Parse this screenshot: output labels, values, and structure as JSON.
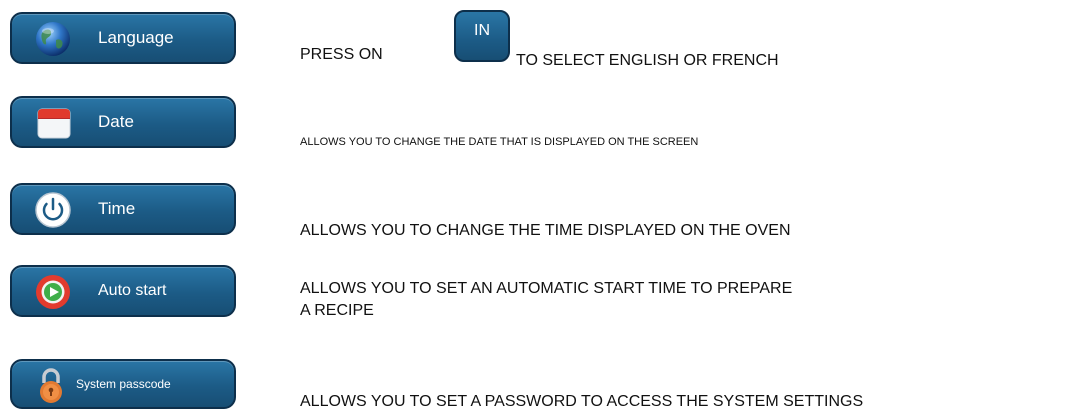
{
  "buttons": {
    "language": {
      "label": "Language",
      "icon": "globe-icon"
    },
    "date": {
      "label": "Date",
      "icon": "calendar-icon"
    },
    "time": {
      "label": "Time",
      "icon": "power-icon"
    },
    "auto_start": {
      "label": "Auto start",
      "icon": "play-icon"
    },
    "system_passcode": {
      "label": "System passcode",
      "icon": "padlock-icon"
    }
  },
  "language_row": {
    "press_on": "PRESS ON",
    "key_label": "IN",
    "instruction": "TO SELECT ENGLISH OR FRENCH"
  },
  "descriptions": {
    "date": "ALLOWS YOU TO CHANGE THE DATE THAT IS DISPLAYED ON THE SCREEN",
    "time": "ALLOWS YOU TO CHANGE THE TIME DISPLAYED ON THE OVEN",
    "auto_start_line1": "ALLOWS YOU TO SET AN AUTOMATIC START TIME TO PREPARE",
    "auto_start_line2": "A RECIPE",
    "system_passcode": "ALLOWS YOU TO SET A PASSWORD TO ACCESS THE SYSTEM SETTINGS"
  },
  "colors": {
    "button_fill": "#1c5b86",
    "button_border": "#0d2f4b",
    "calendar_red": "#e0392d",
    "play_red": "#e23b2e",
    "play_green": "#3fae49"
  }
}
